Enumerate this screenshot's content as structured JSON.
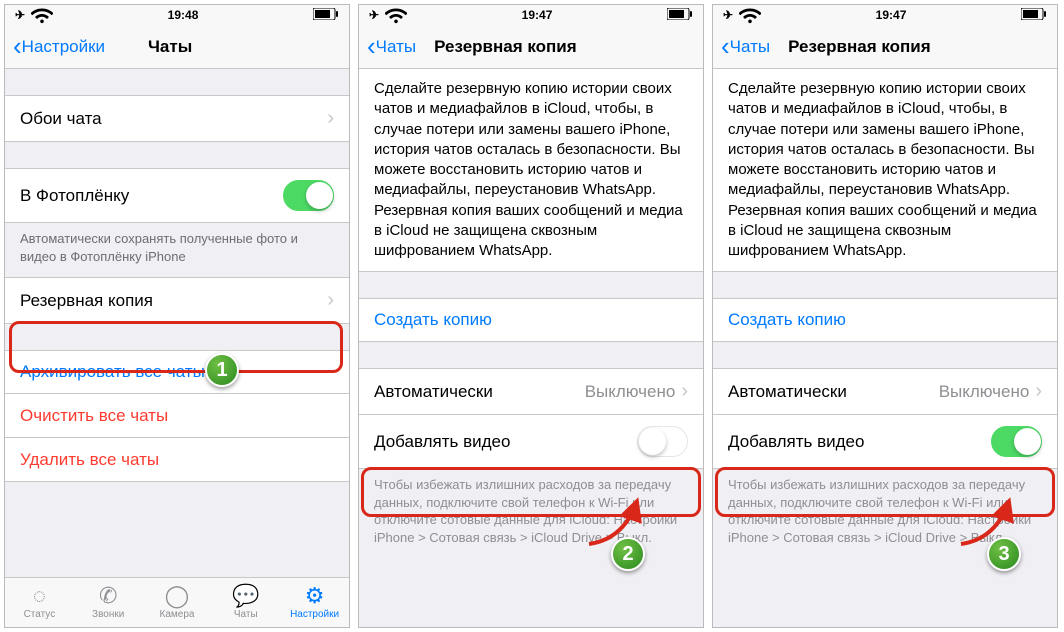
{
  "phone1": {
    "time": "19:48",
    "back": "Настройки",
    "title": "Чаты",
    "wallpaper": "Обои чата",
    "toPhotoRoll": "В Фотоплёнку",
    "toPhotoRollOn": true,
    "photoRollDesc": "Автоматически сохранять полученные фото и видео в Фотоплёнку iPhone",
    "backup": "Резервная копия",
    "archive": "Архивировать все чаты",
    "clear": "Очистить все чаты",
    "delete": "Удалить все чаты",
    "tabs": {
      "status": "Статус",
      "calls": "Звонки",
      "camera": "Камера",
      "chats": "Чаты",
      "settings": "Настройки"
    }
  },
  "phone2": {
    "time": "19:47",
    "back": "Чаты",
    "title": "Резервная копия",
    "info": "Сделайте резервную копию истории своих чатов и медиафайлов в iCloud, чтобы, в случае потери или замены вашего iPhone, история чатов осталась в безопасности. Вы можете восстановить историю чатов и медиафайлы, переустановив WhatsApp. Резервная копия ваших сообщений и медиа в iCloud не защищена сквозным шифрованием WhatsApp.",
    "createBackup": "Создать копию",
    "autoLabel": "Автоматически",
    "autoValue": "Выключено",
    "includeVideo": "Добавлять видео",
    "includeVideoOn": false,
    "bottomNote": "Чтобы избежать излишних расходов за передачу данных, подключите свой телефон к Wi-Fi или отключите сотовые данные для iCloud: Настройки iPhone > Сотовая связь > iCloud Drive > Выкл."
  },
  "phone3": {
    "time": "19:47",
    "back": "Чаты",
    "title": "Резервная копия",
    "info": "Сделайте резервную копию истории своих чатов и медиафайлов в iCloud, чтобы, в случае потери или замены вашего iPhone, история чатов осталась в безопасности. Вы можете восстановить историю чатов и медиафайлы, переустановив WhatsApp. Резервная копия ваших сообщений и медиа в iCloud не защищена сквозным шифрованием WhatsApp.",
    "createBackup": "Создать копию",
    "autoLabel": "Автоматически",
    "autoValue": "Выключено",
    "includeVideo": "Добавлять видео",
    "includeVideoOn": true,
    "bottomNote": "Чтобы избежать излишних расходов за передачу данных, подключите свой телефон к Wi-Fi или отключите сотовые данные для iCloud: Настройки iPhone > Сотовая связь > iCloud Drive > Выкл."
  },
  "steps": {
    "s1": "1",
    "s2": "2",
    "s3": "3"
  }
}
